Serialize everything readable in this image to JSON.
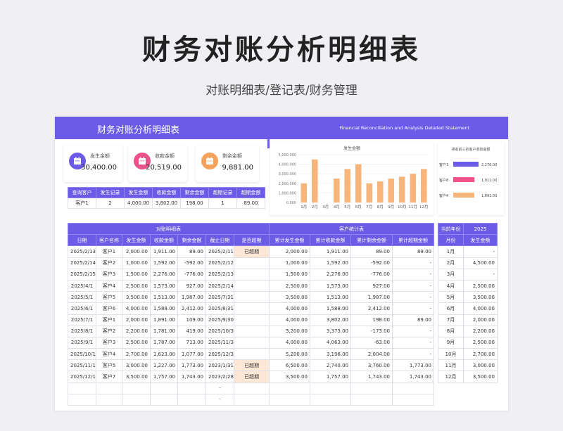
{
  "page": {
    "title": "财务对账分析明细表",
    "subtitle": "对账明细表/登记表/财务管理"
  },
  "banner": {
    "title": "财务对账分析明细表",
    "en": "Financial Reconciliation and Analysis Detailed Statement"
  },
  "kpis": [
    {
      "label": "发生金额",
      "value": "30,400.00",
      "color": "#6b5be6",
      "icon": "calendar-icon"
    },
    {
      "label": "收款金额",
      "value": "20,519.00",
      "color": "#e9528a",
      "icon": "calendar-icon"
    },
    {
      "label": "剩余金额",
      "value": "9,881.00",
      "color": "#f5a25c",
      "icon": "calendar-icon"
    }
  ],
  "query": {
    "headers": [
      "查询客户",
      "发生记录",
      "发生金额",
      "收款金额",
      "剩余金额",
      "超期记录",
      "超期金额"
    ],
    "row": [
      "客户1",
      "2",
      "4,000.00",
      "3,802.00",
      "198.00",
      "1",
      "89.00"
    ]
  },
  "chart_data": [
    {
      "type": "bar",
      "title": "发生金额",
      "categories": [
        "1月",
        "2月",
        "3月",
        "4月",
        "5月",
        "6月",
        "7月",
        "8月",
        "9月",
        "10月",
        "11月",
        "12月"
      ],
      "values": [
        2000,
        4500,
        0,
        2500,
        3500,
        4000,
        2000,
        2200,
        2500,
        2700,
        3000,
        3500
      ],
      "yticks": [
        "0.000",
        "1,000.000",
        "2,000.000",
        "3,000.000",
        "4,000.000",
        "5,000.000"
      ],
      "ylim": [
        0,
        5000
      ],
      "color": "#f7b57c"
    },
    {
      "type": "bar",
      "orientation": "horizontal",
      "title": "排名前三的客户收款金额",
      "categories": [
        "客户3",
        "客户8",
        "客户4"
      ],
      "values": [
        2276,
        1911,
        1891
      ],
      "labels": [
        "2,276.00",
        "1,911.00",
        "1,891.00"
      ],
      "colors": [
        "#6b5be6",
        "#f0538c",
        "#f7b57c"
      ]
    }
  ],
  "ledger": {
    "group_left": "对账明细表",
    "group_right": "客户统计表",
    "headers": [
      "日期",
      "客户名称",
      "发生金额",
      "收款金额",
      "剩余金额",
      "截止日期",
      "是否超期",
      "累计发生金额",
      "累计收款金额",
      "累计剩余金额",
      "累计超期金额"
    ],
    "rows": [
      [
        "2025/2/13",
        "客户1",
        "2,000.00",
        "1,911.00",
        "89.00",
        "2025/2/11",
        "已超期",
        "2,000.00",
        "1,911.00",
        "89.00",
        "89.00"
      ],
      [
        "2025/2/14",
        "客户2",
        "1,000.00",
        "1,592.00",
        "-592.00",
        "2025/2/12",
        "",
        "1,000.00",
        "1,592.00",
        "-592.00",
        "-"
      ],
      [
        "2025/2/15",
        "客户3",
        "1,500.00",
        "2,276.00",
        "-776.00",
        "2025/2/13",
        "",
        "1,500.00",
        "2,276.00",
        "-776.00",
        "-"
      ],
      [
        "2025/4/1",
        "客户4",
        "2,500.00",
        "1,573.00",
        "927.00",
        "2025/2/14",
        "",
        "2,500.00",
        "1,573.00",
        "927.00",
        "-"
      ],
      [
        "2025/5/1",
        "客户5",
        "3,500.00",
        "1,513.00",
        "1,987.00",
        "2025/7/31",
        "",
        "3,500.00",
        "1,513.00",
        "1,987.00",
        "-"
      ],
      [
        "2025/6/1",
        "客户6",
        "4,000.00",
        "1,588.00",
        "2,412.00",
        "2025/8/31",
        "",
        "4,000.00",
        "1,588.00",
        "2,412.00",
        "-"
      ],
      [
        "2025/7/1",
        "客户1",
        "2,000.00",
        "1,891.00",
        "109.00",
        "2025/9/30",
        "",
        "4,000.00",
        "3,802.00",
        "198.00",
        "89.00"
      ],
      [
        "2025/8/1",
        "客户2",
        "2,200.00",
        "1,781.00",
        "419.00",
        "2025/10/31",
        "",
        "3,200.00",
        "3,373.00",
        "-173.00",
        "-"
      ],
      [
        "2025/9/1",
        "客户3",
        "2,500.00",
        "1,787.00",
        "713.00",
        "2025/11/30",
        "",
        "4,000.00",
        "4,063.00",
        "-63.00",
        "-"
      ],
      [
        "2025/10/1",
        "客户4",
        "2,700.00",
        "1,623.00",
        "1,077.00",
        "2025/12/31",
        "",
        "5,200.00",
        "3,196.00",
        "2,004.00",
        "-"
      ],
      [
        "2025/11/1",
        "客户5",
        "3,000.00",
        "1,227.00",
        "1,773.00",
        "2023/1/31",
        "已超期",
        "6,500.00",
        "2,740.00",
        "3,760.00",
        "1,773.00"
      ],
      [
        "2025/12/1",
        "客户7",
        "3,500.00",
        "1,757.00",
        "1,743.00",
        "2023/2/28",
        "已超期",
        "3,500.00",
        "1,757.00",
        "1,743.00",
        "1,743.00"
      ],
      [
        "",
        "",
        "",
        "",
        "",
        "-",
        "",
        "",
        "",
        "",
        ""
      ],
      [
        "",
        "",
        "",
        "",
        "",
        "-",
        "",
        "",
        "",
        "",
        ""
      ]
    ]
  },
  "monthly": {
    "year_label": "当前年份",
    "year": "2025",
    "headers": [
      "月份",
      "发生金额"
    ],
    "rows": [
      [
        "1月",
        "-"
      ],
      [
        "2月",
        "4,500.00"
      ],
      [
        "3月",
        "-"
      ],
      [
        "4月",
        "2,500.00"
      ],
      [
        "5月",
        "3,500.00"
      ],
      [
        "6月",
        "4,000.00"
      ],
      [
        "7月",
        "2,000.00"
      ],
      [
        "8月",
        "2,200.00"
      ],
      [
        "9月",
        "2,500.00"
      ],
      [
        "10月",
        "2,700.00"
      ],
      [
        "11月",
        "3,000.00"
      ],
      [
        "12月",
        "3,500.00"
      ]
    ]
  }
}
